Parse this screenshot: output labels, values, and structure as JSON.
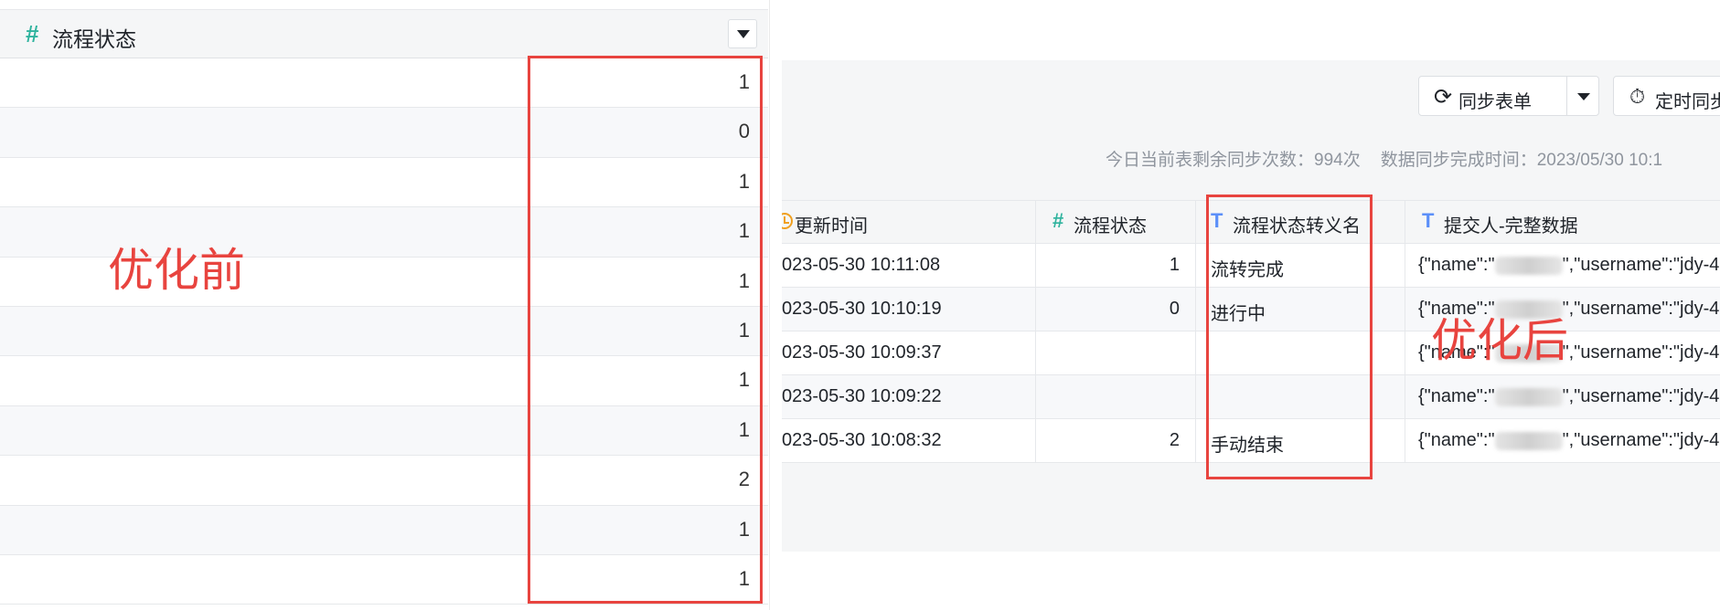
{
  "left": {
    "header": {
      "icon": "hash-icon",
      "title": "流程状态"
    },
    "values": [
      "1",
      "0",
      "1",
      "1",
      "1",
      "1",
      "1",
      "1",
      "2",
      "1",
      "1"
    ],
    "annotation": "优化前",
    "highlight_color": "#e8443f"
  },
  "right": {
    "toolbar": {
      "sync_label": "同步表单",
      "sync_icon": "refresh-icon",
      "timer_label": "定时同步",
      "timer_icon": "stopwatch-icon"
    },
    "sync_info": {
      "remaining": "今日当前表剩余同步次数：994次",
      "completed": "数据同步完成时间：2023/05/30 10:1"
    },
    "columns": [
      {
        "label": "更新时间",
        "icon": "clock-icon"
      },
      {
        "label": "流程状态",
        "icon": "hash-icon"
      },
      {
        "label": "流程状态转义名",
        "icon": "text-icon"
      },
      {
        "label": "提交人-完整数据",
        "icon": "text-icon"
      }
    ],
    "rows": [
      {
        "time": "023-05-30 10:11:08",
        "status": "1",
        "name": "流转完成",
        "submitter_prefix": "{\"name\":\"",
        "submitter_suffix": "\",\"username\":\"jdy-4"
      },
      {
        "time": "023-05-30 10:10:19",
        "status": "0",
        "name": "进行中",
        "submitter_prefix": "{\"name\":\"",
        "submitter_suffix": "\",\"username\":\"jdy-4"
      },
      {
        "time": "023-05-30 10:09:37",
        "status": "",
        "name": "",
        "submitter_prefix": "{\"name\":\"",
        "submitter_suffix": "\",\"username\":\"jdy-4"
      },
      {
        "time": "023-05-30 10:09:22",
        "status": "",
        "name": "",
        "submitter_prefix": "{\"name\":\"",
        "submitter_suffix": "\",\"username\":\"jdy-4"
      },
      {
        "time": "023-05-30 10:08:32",
        "status": "2",
        "name": "手动结束",
        "submitter_prefix": "{\"name\":\"",
        "submitter_suffix": "\",\"username\":\"jdy-4"
      }
    ],
    "annotation": "优化后",
    "highlight_color": "#e8443f"
  }
}
